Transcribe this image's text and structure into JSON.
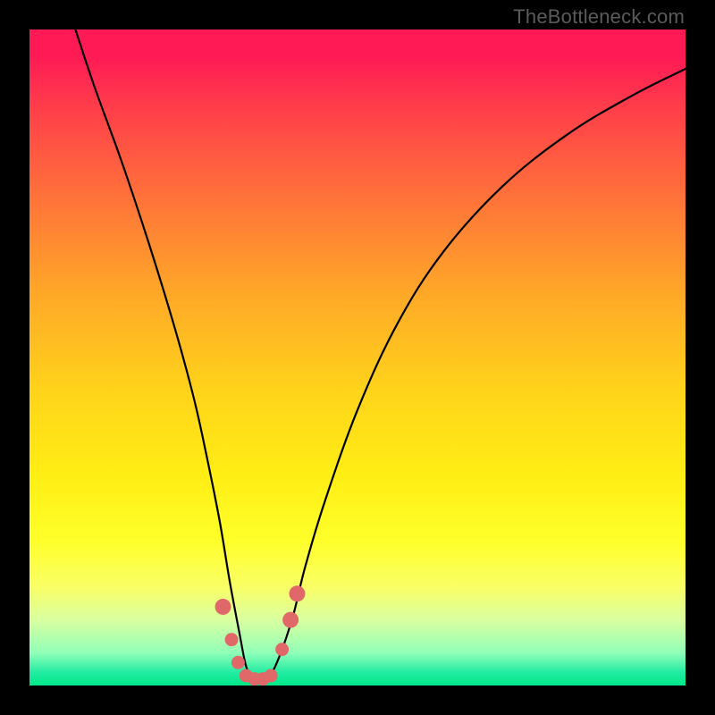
{
  "watermark": "TheBottleneck.com",
  "chart_data": {
    "type": "line",
    "title": "",
    "xlabel": "",
    "ylabel": "",
    "xlim": [
      0,
      100
    ],
    "ylim": [
      0,
      100
    ],
    "background_gradient_stops": [
      {
        "pct": 0,
        "color": "#ff1a55"
      },
      {
        "pct": 4,
        "color": "#ff1a55"
      },
      {
        "pct": 12,
        "color": "#ff3e4a"
      },
      {
        "pct": 28,
        "color": "#ff7b37"
      },
      {
        "pct": 40,
        "color": "#ffa728"
      },
      {
        "pct": 55,
        "color": "#ffd31a"
      },
      {
        "pct": 68,
        "color": "#ffee14"
      },
      {
        "pct": 78,
        "color": "#ffff2a"
      },
      {
        "pct": 85,
        "color": "#f9ff66"
      },
      {
        "pct": 90,
        "color": "#d9ffa0"
      },
      {
        "pct": 95,
        "color": "#91ffb8"
      },
      {
        "pct": 98,
        "color": "#22eca3"
      },
      {
        "pct": 100,
        "color": "#00e888"
      }
    ],
    "series": [
      {
        "name": "v-curve",
        "color": "#000000",
        "x": [
          7,
          10,
          14,
          18,
          22,
          25,
          27,
          29,
          30.5,
          32,
          33,
          34,
          35,
          36,
          37.5,
          40,
          42,
          45,
          50,
          56,
          63,
          72,
          82,
          92,
          100
        ],
        "y": [
          100,
          91,
          80,
          68,
          55,
          44,
          35,
          25,
          16,
          8,
          3,
          1,
          1,
          1,
          3,
          10,
          18,
          28,
          42,
          55,
          66,
          76,
          84,
          90,
          94
        ]
      }
    ],
    "markers": {
      "name": "valley-dots",
      "color": "#e06868",
      "radius_large": 9,
      "radius_small": 7.5,
      "points": [
        {
          "x": 29.5,
          "y": 12,
          "r": "large"
        },
        {
          "x": 30.8,
          "y": 7,
          "r": "small"
        },
        {
          "x": 31.8,
          "y": 3.5,
          "r": "small"
        },
        {
          "x": 33.0,
          "y": 1.5,
          "r": "small"
        },
        {
          "x": 34.3,
          "y": 1.0,
          "r": "small"
        },
        {
          "x": 35.6,
          "y": 1.0,
          "r": "small"
        },
        {
          "x": 36.8,
          "y": 1.5,
          "r": "small"
        },
        {
          "x": 38.5,
          "y": 5.5,
          "r": "small"
        },
        {
          "x": 39.8,
          "y": 10,
          "r": "large"
        },
        {
          "x": 40.8,
          "y": 14,
          "r": "large"
        }
      ]
    }
  }
}
